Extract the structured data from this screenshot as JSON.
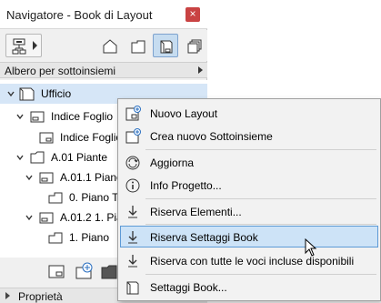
{
  "window": {
    "title": "Navigatore - Book di Layout",
    "close_glyph": "×"
  },
  "toolbar": {
    "buttons": [
      {
        "icon": "tree-dropdown-icon"
      },
      {
        "icon": "project-map-icon"
      },
      {
        "icon": "view-map-icon"
      },
      {
        "icon": "layout-book-icon",
        "active": true
      },
      {
        "icon": "publisher-sets-icon"
      }
    ]
  },
  "combo": {
    "value": "Albero per sottoinsiemi"
  },
  "tree": {
    "items": [
      {
        "label": "Ufficio",
        "selected": true
      },
      {
        "label": "Indice Foglio"
      },
      {
        "label": "Indice Foglio"
      },
      {
        "label": "A.01 Piante"
      },
      {
        "label": "A.01.1 Piano"
      },
      {
        "label": "0. Piano Te"
      },
      {
        "label": "A.01.2 1. Pia"
      },
      {
        "label": "1. Piano"
      }
    ]
  },
  "properties": {
    "label": "Proprietà"
  },
  "context_menu": {
    "items": [
      {
        "label": "Nuovo Layout",
        "icon": "new-layout-icon"
      },
      {
        "label": "Crea nuovo Sottoinsieme",
        "icon": "new-subset-icon"
      },
      {
        "label": "Aggiorna",
        "icon": "refresh-icon"
      },
      {
        "label": "Info Progetto...",
        "icon": "info-icon"
      },
      {
        "label": "Riserva Elementi...",
        "icon": "reserve-elements-icon"
      },
      {
        "label": "Riserva Settaggi Book",
        "icon": "reserve-settings-icon",
        "highlighted": true
      },
      {
        "label": "Riserva con tutte le voci incluse disponibili",
        "icon": "reserve-all-icon"
      },
      {
        "label": "Settaggi Book...",
        "icon": "book-settings-icon"
      }
    ]
  },
  "colors": {
    "selection": "#d6e6f7",
    "menu_highlight": "#cde3f7",
    "close_button": "#c94343"
  }
}
